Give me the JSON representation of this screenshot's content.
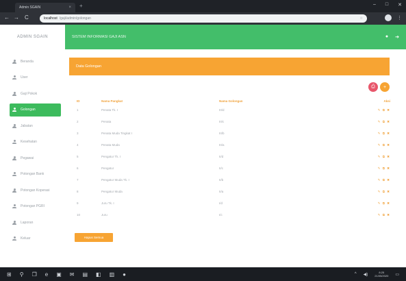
{
  "browser": {
    "tab_title": "Admin SGAIN",
    "tab_close": "×",
    "new_tab": "+",
    "win_min": "–",
    "win_max": "□",
    "win_close": "✕",
    "back": "←",
    "forward": "→",
    "reload": "C",
    "address_host": "localhost",
    "address_path": "/gaji/admin/golongan",
    "star": "☆",
    "menu_dots": "⋮"
  },
  "sidebar": {
    "brand": "ADMIN SGAIN",
    "items": [
      {
        "label": "Beranda",
        "active": false
      },
      {
        "label": "User",
        "active": false
      },
      {
        "label": "Gaji Pokok",
        "active": false
      },
      {
        "label": "Golongan",
        "active": true
      },
      {
        "label": "Jabatan",
        "active": false
      },
      {
        "label": "Kesehatan",
        "active": false
      },
      {
        "label": "Pegawai",
        "active": false
      },
      {
        "label": "Potongan Bank",
        "active": false
      },
      {
        "label": "Potongan Koperasi",
        "active": false
      },
      {
        "label": "Potongan PGRI",
        "active": false
      },
      {
        "label": "Laporan",
        "active": false
      },
      {
        "label": "Keluar",
        "active": false
      }
    ]
  },
  "appbar": {
    "title": "SISTEM INFORMASI GAJI ASN",
    "user_icon": "●",
    "logout_icon": "➔"
  },
  "panel": {
    "title": "Data Golongan"
  },
  "actions": {
    "print": "⎙",
    "add": "+"
  },
  "table": {
    "headers": [
      "ID",
      "Nama Pangkat",
      "Nama Golongan",
      "Aksi"
    ],
    "rows": [
      {
        "id": "1",
        "pangkat": "Penata Tk. I",
        "golongan": "III/d"
      },
      {
        "id": "2",
        "pangkat": "Penata",
        "golongan": "III/c"
      },
      {
        "id": "3",
        "pangkat": "Penata Muda Tingkat I",
        "golongan": "III/b"
      },
      {
        "id": "4",
        "pangkat": "Penata Muda",
        "golongan": "III/a"
      },
      {
        "id": "5",
        "pangkat": "Pengatur Tk. I",
        "golongan": "II/d"
      },
      {
        "id": "6",
        "pangkat": "Pengatur",
        "golongan": "II/c"
      },
      {
        "id": "7",
        "pangkat": "Pengatur Muda Tk. I",
        "golongan": "II/b"
      },
      {
        "id": "8",
        "pangkat": "Pengatur Muda",
        "golongan": "II/a"
      },
      {
        "id": "9",
        "pangkat": "Juru Tk. I",
        "golongan": "I/d"
      },
      {
        "id": "10",
        "pangkat": "Juru",
        "golongan": "I/c"
      }
    ],
    "aksi_icons": "✎ ⧉ ✖"
  },
  "bottom_button": "Hapus Semua",
  "taskbar": {
    "start": "⊞",
    "search": "⚲",
    "task_view": "❐",
    "apps": [
      "e",
      "▣",
      "✉",
      "▤",
      "◧",
      "▥",
      "●"
    ],
    "tray_up": "^",
    "volume": "◀)",
    "time": "8:25",
    "date": "21/05/2020",
    "notify": "▭"
  },
  "colors": {
    "accent_green": "#43be6a",
    "accent_orange": "#f7a433",
    "danger": "#e8566b"
  }
}
